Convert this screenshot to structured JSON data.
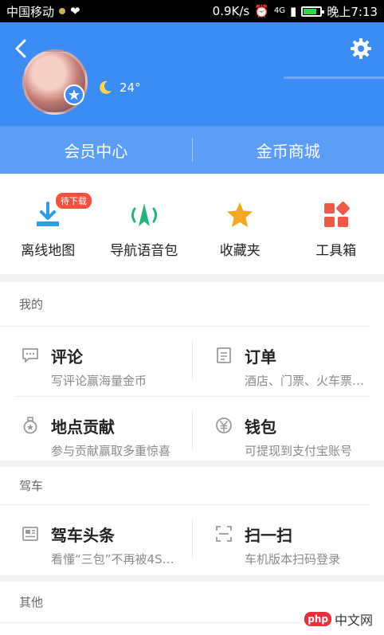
{
  "status_bar": {
    "carrier": "中国移动",
    "speed": "0.9K/s",
    "signal": "4G",
    "battery": "73",
    "time": "晚上7:13"
  },
  "header": {
    "temperature": "24°"
  },
  "member_bar": {
    "member_center": "会员中心",
    "coin_mall": "金币商城"
  },
  "tools": [
    {
      "label": "离线地图",
      "badge": "待下载",
      "icon": "download-icon",
      "color": "#2f9ae6"
    },
    {
      "label": "导航语音包",
      "icon": "navigation-voice-icon",
      "color": "#26b37a"
    },
    {
      "label": "收藏夹",
      "icon": "star-icon",
      "color": "#f5a623"
    },
    {
      "label": "工具箱",
      "icon": "toolbox-icon",
      "color": "#ee5a49"
    }
  ],
  "my": {
    "title": "我的",
    "rows": [
      [
        {
          "title": "评论",
          "sub": "写评论赢海量金币",
          "icon": "comment-icon"
        },
        {
          "title": "订单",
          "sub": "酒店、门票、火车票…",
          "icon": "order-icon"
        }
      ],
      [
        {
          "title": "地点贡献",
          "sub": "参与贡献赢取多重惊喜",
          "icon": "medal-icon"
        },
        {
          "title": "钱包",
          "sub": "可提现到支付宝账号",
          "icon": "wallet-icon"
        }
      ]
    ]
  },
  "drive": {
    "title": "驾车",
    "rows": [
      [
        {
          "title": "驾车头条",
          "sub": "看懂“三包”不再被4S…",
          "icon": "news-icon"
        },
        {
          "title": "扫一扫",
          "sub": "车机版本扫码登录",
          "icon": "scan-icon"
        }
      ]
    ]
  },
  "other": {
    "title": "其他"
  },
  "watermark": {
    "php": "php",
    "cn": "中文网"
  }
}
